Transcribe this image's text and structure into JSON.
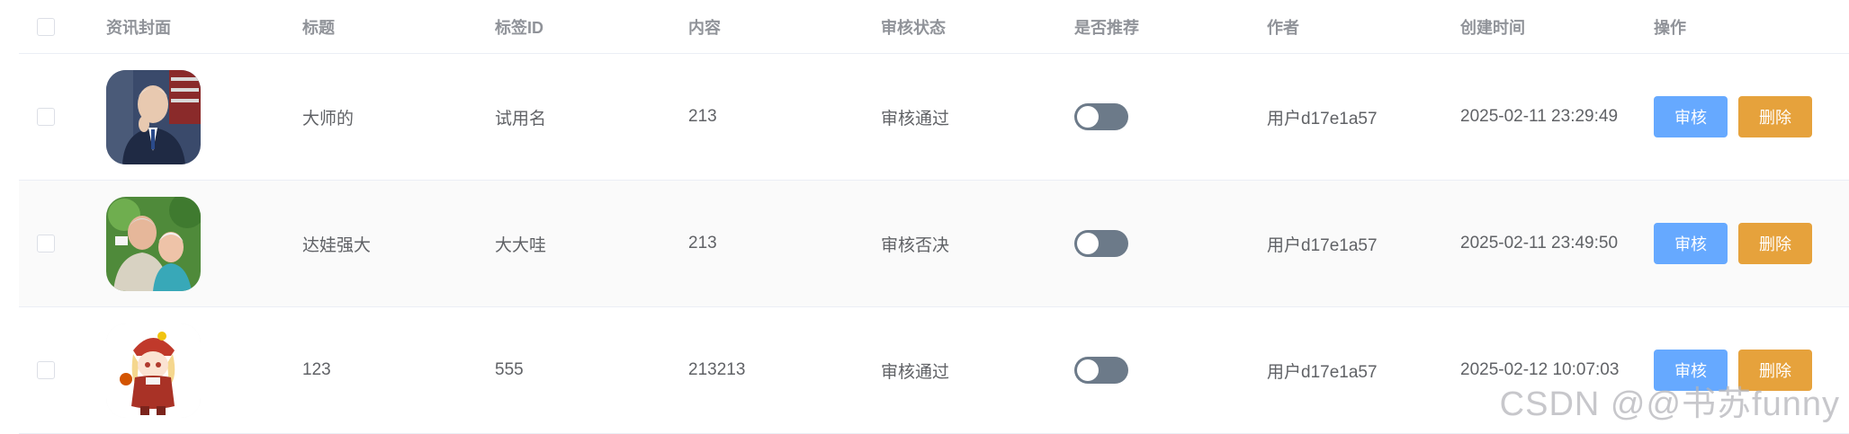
{
  "header": {
    "cover": "资讯封面",
    "title": "标题",
    "tag_id": "标签ID",
    "content": "内容",
    "status": "审核状态",
    "recommended": "是否推荐",
    "author": "作者",
    "created_at": "创建时间",
    "actions": "操作"
  },
  "rows": [
    {
      "cover_icon": "portrait-photo",
      "title": "大师的",
      "tag_id": "试用名",
      "content": "213",
      "status": "审核通过",
      "recommended": false,
      "author": "用户d17e1a57",
      "created_at": "2025-02-11 23:29:49",
      "review_label": "审核",
      "delete_label": "删除"
    },
    {
      "cover_icon": "couple-photo",
      "title": "达娃强大",
      "tag_id": "大大哇",
      "content": "213",
      "status": "审核否决",
      "recommended": false,
      "author": "用户d17e1a57",
      "created_at": "2025-02-11 23:49:50",
      "review_label": "审核",
      "delete_label": "删除"
    },
    {
      "cover_icon": "anime-character-image",
      "title": "123",
      "tag_id": "555",
      "content": "213213",
      "status": "审核通过",
      "recommended": false,
      "author": "用户d17e1a57",
      "created_at": "2025-02-12 10:07:03",
      "review_label": "审核",
      "delete_label": "删除"
    }
  ],
  "watermark": "CSDN @@书苏funny",
  "colors": {
    "review_button": "#66a9ff",
    "delete_button": "#e6a23c",
    "toggle_off": "#6c7a89"
  }
}
